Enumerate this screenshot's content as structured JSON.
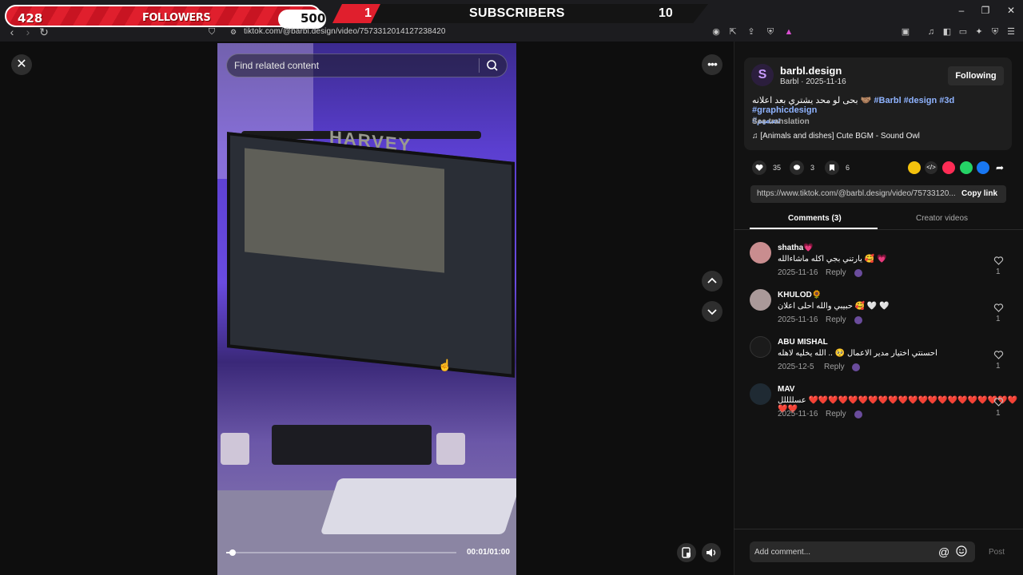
{
  "overlay": {
    "followers_current": "428",
    "followers_label": "FOLLOWERS",
    "followers_goal": "500",
    "subscribers_current": "1",
    "subscribers_label": "SUBSCRIBERS",
    "subscribers_goal": "10"
  },
  "browser": {
    "url": "tiktok.com/@barbl.design/video/7573312014127238420"
  },
  "video": {
    "search_placeholder": "Find related content",
    "time": "00:01/01:00",
    "progress_fraction": 0.02,
    "screen_text": "HARVEY"
  },
  "author": {
    "name": "barbl.design",
    "sub": "Barbl · 2025-11-16",
    "avatar_letter": "S",
    "follow_label": "Following",
    "description_text": "بحى لو محد يشتري بعد اعلانه 🤝🏽 ",
    "hashtags": "#Barbl #design #3d #graphicdesign",
    "hashtag2": "#تصميم",
    "see_translation": "See translation",
    "music": "♫  [Animals and dishes] Cute BGM - Sound Owl"
  },
  "actions": {
    "likes": "35",
    "comments": "3",
    "saves": "6"
  },
  "link": {
    "url": "https://www.tiktok.com/@barbl.design/video/75733120...",
    "copy_label": "Copy link"
  },
  "tabs": {
    "comments": "Comments (3)",
    "creator": "Creator videos"
  },
  "comments": [
    {
      "name": "shatha💗",
      "text": "يارتني بجي اكله ماشاءالله 🥰 💗",
      "date": "2025-11-16",
      "reply": "Reply",
      "likes": "1"
    },
    {
      "name": "KHULOD🌻",
      "text": "حبيبي والله احلى اعلان 🥰 🤍 🤍",
      "date": "2025-11-16",
      "reply": "Reply",
      "likes": "1"
    },
    {
      "name": "ABU MISHAL",
      "text": "احسنتي اختيار مدير الاعمال 🥺 .. الله يخليه لاهله",
      "date": "2025-12-5",
      "reply": "Reply",
      "likes": "1"
    },
    {
      "name": "MAV",
      "text": "عسللللل ❤️❤️❤️❤️❤️❤️❤️❤️❤️❤️❤️❤️❤️❤️❤️❤️❤️❤️❤️❤️❤️❤️❤️",
      "date": "2025-11-16",
      "reply": "Reply",
      "likes": "1"
    }
  ],
  "composer": {
    "placeholder": "Add comment...",
    "at_symbol": "@",
    "post_label": "Post"
  },
  "colors": {
    "accent_red": "#e01f2d",
    "hashtag_blue": "#8fb3ff",
    "panel_bg": "#121212"
  }
}
